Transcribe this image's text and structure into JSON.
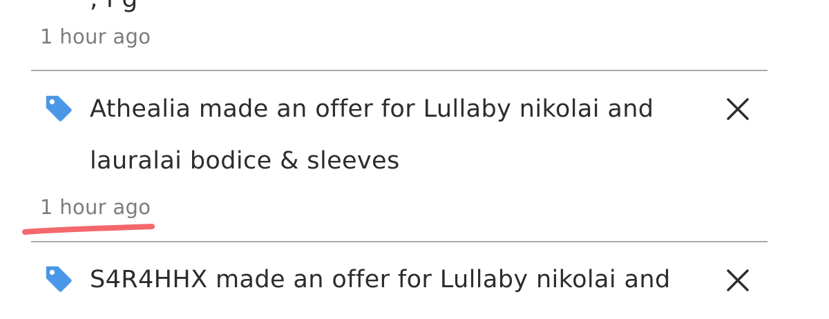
{
  "previous_item": {
    "partial_text": ", l  g   ",
    "timestamp": "1 hour ago"
  },
  "notifications": [
    {
      "icon": "tag-icon",
      "line1": "Athealia made an offer for Lullaby nikolai and",
      "line2": "lauralai bodice & sleeves",
      "timestamp": "1 hour ago"
    },
    {
      "icon": "tag-icon",
      "line1": "S4R4HHX made an offer for Lullaby nikolai and"
    }
  ],
  "colors": {
    "tag_icon": "#4a97e8",
    "timestamp": "#7c7c7c",
    "text": "#2c2c2c",
    "divider": "#a9a9a9",
    "highlight": "#f2585c"
  }
}
